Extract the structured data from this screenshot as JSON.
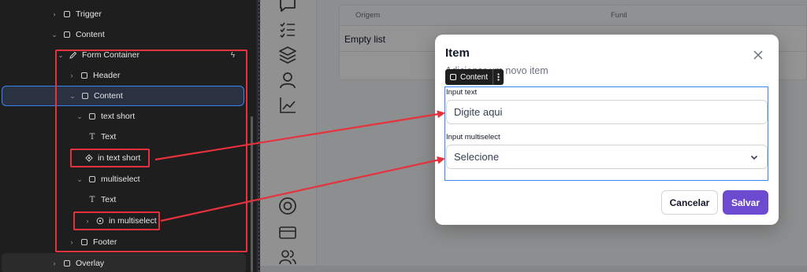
{
  "tree": {
    "items": [
      {
        "label": "Trigger",
        "chev": "›",
        "icon": "box"
      },
      {
        "label": "Content",
        "chev": "⌄",
        "icon": "box"
      },
      {
        "label": "Form Container",
        "chev": "⌄",
        "icon": "pencil"
      },
      {
        "label": "Header",
        "chev": "›",
        "icon": "box"
      },
      {
        "label": "Content",
        "chev": "⌄",
        "icon": "box"
      },
      {
        "label": "text short",
        "chev": "⌄",
        "icon": "box"
      },
      {
        "label": "Text",
        "chev": "",
        "icon": "T"
      },
      {
        "label": "in text short",
        "chev": "",
        "icon": "component"
      },
      {
        "label": "multiselect",
        "chev": "⌄",
        "icon": "box"
      },
      {
        "label": "Text",
        "chev": "",
        "icon": "T"
      },
      {
        "label": "in multiselect",
        "chev": "›",
        "icon": "component"
      },
      {
        "label": "Footer",
        "chev": "›",
        "icon": "box"
      },
      {
        "label": "Overlay",
        "chev": "›",
        "icon": "box"
      }
    ]
  },
  "background": {
    "columns": [
      "Origem",
      "Funil"
    ],
    "empty_text": "Empty list"
  },
  "modal": {
    "title": "Item",
    "subtitle": "Adicionar um novo item",
    "chip_label": "Content",
    "fields": [
      {
        "label": "Input text",
        "placeholder": "Digite aqui"
      },
      {
        "label": "Input multiselect",
        "placeholder": "Selecione"
      }
    ],
    "cancel_label": "Cancelar",
    "save_label": "Salvar"
  },
  "colors": {
    "accent": "#6d4bd1",
    "annotation_red": "#e5323c",
    "selection_blue": "#3b82f6"
  }
}
